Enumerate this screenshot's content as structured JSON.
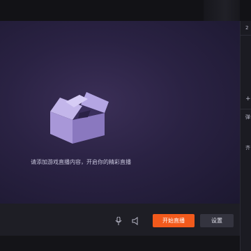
{
  "preview": {
    "hint_text": "请添加游戏直播内容，开启你的精彩直播"
  },
  "bottom_bar": {
    "start_button_label": "开始直播",
    "settings_button_label": "设置"
  },
  "side_panel": {
    "top_label": "2",
    "plus_label": "+",
    "mid_label": "弹",
    "lower_label": "齐"
  },
  "colors": {
    "accent": "#f25a1c",
    "preview_bg": "#2a2243"
  }
}
